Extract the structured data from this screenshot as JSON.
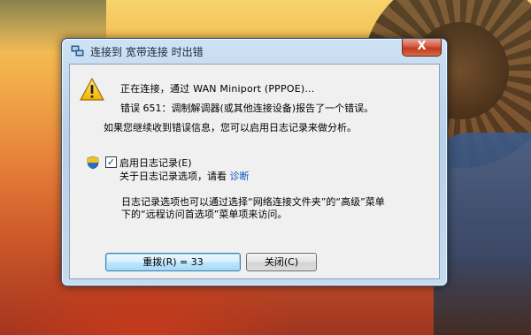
{
  "window": {
    "title": "连接到 宽带连接 时出错",
    "close_glyph": "X"
  },
  "message": {
    "line1": "正在连接，通过 WAN Miniport (PPPOE)...",
    "line2": "错误 651：调制解调器(或其他连接设备)报告了一个错误。",
    "line3": "如果您继续收到错误信息，您可以启用日志记录来做分析。"
  },
  "logging": {
    "checkbox_checked": true,
    "checkbox_label": "启用日志记录(E)",
    "info_text": "关于日志记录选项，请看",
    "diagnose_link": "诊断"
  },
  "note": {
    "line1": "日志记录选项也可以通过选择“网络连接文件夹”的“高级”菜单",
    "line2": "下的“远程访问首选项”菜单项来访问。"
  },
  "buttons": {
    "redial": "重拨(R) = 33",
    "close": "关闭(C)"
  },
  "icons": {
    "title": "network-connection-icon",
    "warning": "warning-icon",
    "uac": "uac-shield-icon"
  }
}
